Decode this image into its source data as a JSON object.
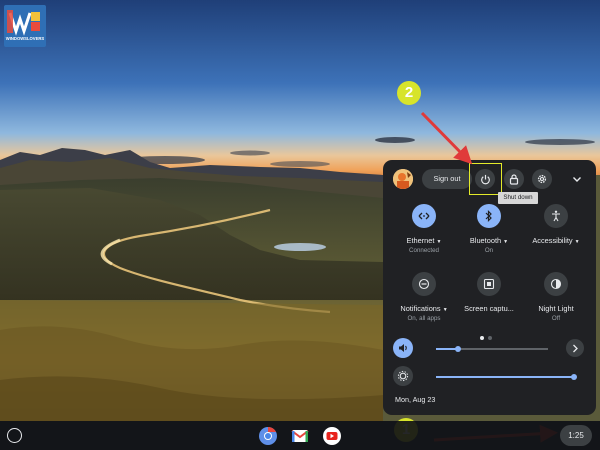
{
  "watermark": {
    "text": "WINDOWSLOVERS"
  },
  "quick_settings": {
    "sign_out_label": "Sign out",
    "tooltip": "Shut down",
    "tiles": [
      {
        "label": "Ethernet",
        "sub": "Connected",
        "icon": "ethernet-icon",
        "active": true
      },
      {
        "label": "Bluetooth",
        "sub": "On",
        "icon": "bluetooth-icon",
        "active": true
      },
      {
        "label": "Accessibility",
        "sub": "",
        "icon": "accessibility-icon",
        "active": false
      },
      {
        "label": "Notifications",
        "sub": "On, all apps",
        "icon": "notifications-icon",
        "active": false
      },
      {
        "label": "Screen captu...",
        "sub": "",
        "icon": "screen-capture-icon",
        "active": false
      },
      {
        "label": "Night Light",
        "sub": "Off",
        "icon": "night-light-icon",
        "active": false
      }
    ],
    "volume_level": 0.2,
    "brightness_level": 1.0,
    "page_count": 2,
    "active_page": 1,
    "date": "Mon, Aug 23"
  },
  "callouts": {
    "step1": "1",
    "step2": "2"
  },
  "shelf": {
    "apps": [
      "chrome-icon",
      "gmail-icon",
      "youtube-icon"
    ],
    "clock": "1:25"
  },
  "colors": {
    "accent": "#8ab4f8",
    "panel": "#202124",
    "highlight": "#e3ea2a",
    "arrow": "#e03a3a",
    "badge": "#d7e42b"
  }
}
